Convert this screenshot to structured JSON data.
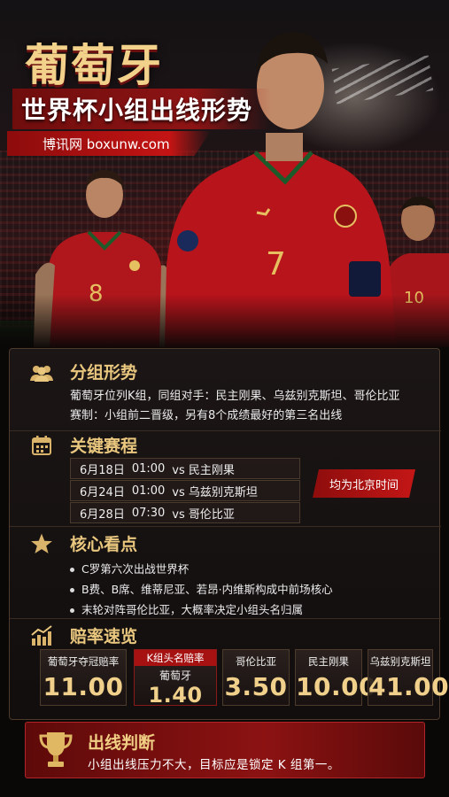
{
  "header": {
    "title": "葡萄牙",
    "subtitle": "世界杯小组出线形势",
    "site": "博讯网 boxunw.com"
  },
  "players": {
    "left_number": "8",
    "center_number": "7",
    "right_number": "10"
  },
  "group": {
    "title": "分组形势",
    "icon": "group-icon",
    "lines": [
      "葡萄牙位列K组，同组对手：民主刚果、乌兹别克斯坦、哥伦比亚",
      "赛制：小组前二晋级，另有8个成绩最好的第三名出线"
    ]
  },
  "fixtures": {
    "title": "关键赛程",
    "icon": "calendar-icon",
    "items": [
      {
        "date": "6月18日",
        "time": "01:00",
        "opponent": "vs 民主刚果"
      },
      {
        "date": "6月24日",
        "time": "01:00",
        "opponent": "vs 乌兹别克斯坦"
      },
      {
        "date": "6月28日",
        "time": "07:30",
        "opponent": "vs 哥伦比亚"
      }
    ],
    "timezone_note": "均为北京时间"
  },
  "highlights": {
    "title": "核心看点",
    "icon": "star-icon",
    "items": [
      "C罗第六次出战世界杯",
      "B费、B席、维蒂尼亚、若昂·内维斯构成中前场核心",
      "末轮对阵哥伦比亚，大概率决定小组头名归属"
    ]
  },
  "odds": {
    "title": "赔率速览",
    "icon": "chart-icon",
    "cards": [
      {
        "label": "葡萄牙夺冠赔率",
        "value": "11.00"
      },
      {
        "label": "K组头名赔率",
        "team": "葡萄牙",
        "value": "1.40"
      },
      {
        "label": "哥伦比亚",
        "value": "3.50"
      },
      {
        "label": "民主刚果",
        "value": "10.00"
      },
      {
        "label": "乌兹别克斯坦",
        "value": "41.00"
      }
    ]
  },
  "verdict": {
    "title": "出线判断",
    "icon": "trophy-icon",
    "text": "小组出线压力不大，目标应是锁定 K 组第一。"
  }
}
